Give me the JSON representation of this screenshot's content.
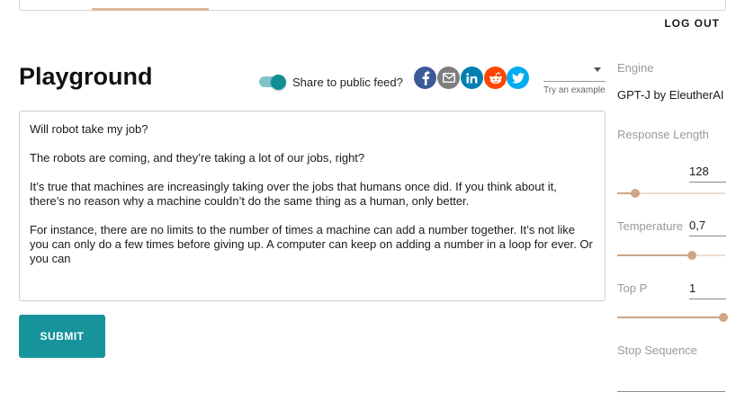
{
  "header": {
    "logout_label": "LOG OUT"
  },
  "page": {
    "title": "Playground"
  },
  "share": {
    "label": "Share to public feed?",
    "enabled": true,
    "icons": [
      "facebook-icon",
      "email-icon",
      "linkedin-icon",
      "reddit-icon",
      "twitter-icon"
    ],
    "colors": {
      "facebook": "#3b5998",
      "email": "#7f7f7f",
      "linkedin": "#007fb1",
      "reddit": "#ff4500",
      "twitter": "#00aced"
    }
  },
  "examples": {
    "selected": "",
    "hint": "Try an example"
  },
  "prompt": {
    "paragraphs": [
      "Will robot take my job?",
      "The robots are coming, and they’re taking a lot of our jobs, right?",
      "It’s true that machines are increasingly taking over the jobs that humans once did. If you think about it, there’s no reason why a machine couldn’t do the same thing as a human, only better.",
      "For instance, there are no limits to the number of times a machine can add a number together. It’s not like you can only do a few times before giving up. A computer can keep on adding a number in a loop for ever. Or you can"
    ]
  },
  "submit": {
    "label": "SUBMIT"
  },
  "settings": {
    "engine_label": "Engine",
    "engine_value": "GPT-J by EleutherAI",
    "response_length_label": "Response Length",
    "response_length_value": "128",
    "response_length_fraction": 0.15,
    "temperature_label": "Temperature",
    "temperature_value": "0,7",
    "temperature_fraction": 0.7,
    "top_p_label": "Top P",
    "top_p_value": "1",
    "top_p_fraction": 1.0,
    "stop_sequence_label": "Stop Sequence",
    "stop_sequence_value": ""
  },
  "colors": {
    "accent": "#17949b",
    "slider": "#cfa586"
  }
}
